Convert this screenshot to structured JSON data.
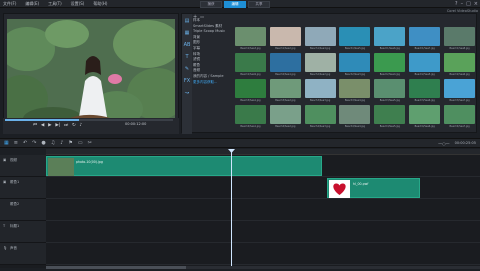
{
  "menu": [
    "文件(F)",
    "编辑(E)",
    "工具(T)",
    "设置(S)",
    "帮助(H)"
  ],
  "tabs": [
    "捕获",
    "编辑",
    "共享"
  ],
  "active_tab": 1,
  "app_name": "Corel VideoStudio",
  "library": {
    "tree": [
      "样本",
      "SmartSlides 素材",
      "Triple Scoop Music",
      "背景",
      "图形",
      "字幕",
      "转场",
      "滤镜",
      "覆叠",
      "音频",
      "我的内容 / Sample",
      "更多内容获取..."
    ],
    "highlight_index": 11,
    "thumbnails": [
      {
        "caption": "Beach1/Sea3.jpg",
        "color": "#6b8f6e"
      },
      {
        "caption": "Beach1/Sea2.jpg",
        "color": "#c9b8ad"
      },
      {
        "caption": "Beach1/Sea4.jpg",
        "color": "#8fa9b8"
      },
      {
        "caption": "Beach1/Sea5.jpg",
        "color": "#2a8fb5"
      },
      {
        "caption": "Beach1/Sea6.jpg",
        "color": "#4ba3c8"
      },
      {
        "caption": "Beach1/Sea7.jpg",
        "color": "#3f8fc4"
      },
      {
        "caption": "Beach1/Sea8.jpg",
        "color": "#5a7a6a"
      },
      {
        "caption": "Beach1/Sea9.jpg",
        "color": "#3a7a4a"
      },
      {
        "caption": "Beach2/Sea1.jpg",
        "color": "#2d6fa0"
      },
      {
        "caption": "Beach2/Sea2.jpg",
        "color": "#9fb1a5"
      },
      {
        "caption": "Beach2/Sea3.jpg",
        "color": "#2f8bb8"
      },
      {
        "caption": "Beach2/Sea4.jpg",
        "color": "#3b9a4f"
      },
      {
        "caption": "Beach2/Sea5.jpg",
        "color": "#3e9ac9"
      },
      {
        "caption": "Beach2/Sea6.jpg",
        "color": "#5aa25a"
      },
      {
        "caption": "Beach3/Sea1.jpg",
        "color": "#2e7d3e"
      },
      {
        "caption": "Beach3/Sea2.jpg",
        "color": "#6f9a7a"
      },
      {
        "caption": "Beach3/Sea3.jpg",
        "color": "#8fb2c4"
      },
      {
        "caption": "Beach3/Sea4.jpg",
        "color": "#7a8f6a"
      },
      {
        "caption": "Beach3/Sea5.jpg",
        "color": "#5a8f70"
      },
      {
        "caption": "Beach3/Sea6.jpg",
        "color": "#2f7f4f"
      },
      {
        "caption": "Beach3/Sea7.jpg",
        "color": "#4aa3d6"
      },
      {
        "caption": "Beach4/Sea1.jpg",
        "color": "#3a7a4a"
      },
      {
        "caption": "Beach4/Sea2.jpg",
        "color": "#7aa08a"
      },
      {
        "caption": "Beach4/Sea3.jpg",
        "color": "#4f8f5f"
      },
      {
        "caption": "Beach4/Sea4.jpg",
        "color": "#6f8a7a"
      },
      {
        "caption": "Beach4/Sea5.jpg",
        "color": "#3f7f4f"
      },
      {
        "caption": "Beach4/Sea6.jpg",
        "color": "#5f9f6f"
      },
      {
        "caption": "Beach4/Sea7.jpg",
        "color": "#4f8f60"
      }
    ]
  },
  "timecode": "00:00:12:00",
  "timeline": {
    "timecode_right": "00:00:25:05",
    "tracks": [
      {
        "name": "视频"
      },
      {
        "name": "覆叠1"
      },
      {
        "name": "覆叠2"
      },
      {
        "name": "标题1"
      },
      {
        "name": "声音"
      },
      {
        "name": "音乐1"
      }
    ],
    "clip_video_label": "photo-10(00).jpg",
    "clip_overlay_label": "hl_00.pwf"
  }
}
